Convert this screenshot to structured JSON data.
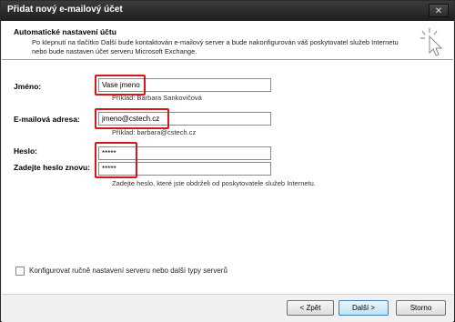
{
  "window": {
    "title": "Přidat nový e-mailový účet",
    "close_glyph": "✕"
  },
  "header": {
    "title": "Automatické nastavení účtu",
    "description": "Po klepnutí na tlačítko Další bude kontaktován e-mailový server a bude nakonfigurován váš poskytovatel služeb Internetu nebo bude nastaven účet serveru Microsoft Exchange.",
    "icon": "cursor-click-icon"
  },
  "form": {
    "name": {
      "label": "Jméno:",
      "value": "Vase jmeno",
      "hint": "Příklad: Barbara Sankovičová"
    },
    "email": {
      "label": "E-mailová adresa:",
      "value": "jmeno@cstech.cz",
      "hint": "Příklad: barbara@cstech.cz"
    },
    "password": {
      "label": "Heslo:",
      "value": "*****"
    },
    "password_repeat": {
      "label": "Zadejte heslo znovu:",
      "value": "*****",
      "hint": "Zadejte heslo, které jste obdrželi od poskytovatele služeb Internetu."
    },
    "highlight_color": "#d9141b"
  },
  "manual_config": {
    "label": "Konfigurovat ručně nastavení serveru nebo další typy serverů",
    "checked": false
  },
  "footer": {
    "back": "< Zpět",
    "next": "Další >",
    "cancel": "Storno"
  }
}
